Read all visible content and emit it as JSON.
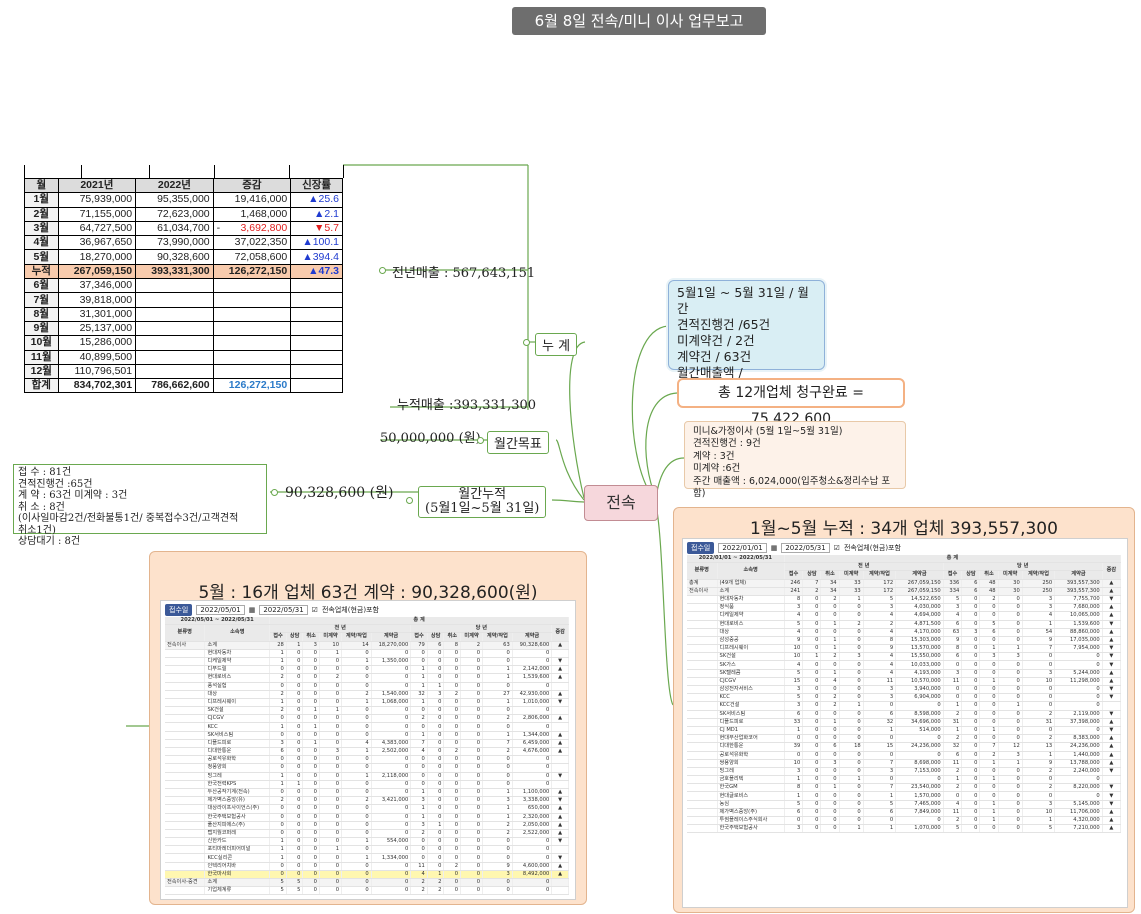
{
  "title": "6월 8일 전속/미니 이사 업무보고",
  "monthly_table": {
    "headers": [
      "월",
      "2021년",
      "2022년",
      "증감",
      "신장률"
    ],
    "rows": [
      {
        "month": "1월",
        "y2021": "75,939,000",
        "y2022": "95,355,000",
        "diff": "19,416,000",
        "rate": "▲25.6",
        "dir": "up"
      },
      {
        "month": "2월",
        "y2021": "71,155,000",
        "y2022": "72,623,000",
        "diff": "1,468,000",
        "rate": "▲2.1",
        "dir": "up"
      },
      {
        "month": "3월",
        "y2021": "64,727,500",
        "y2022": "61,034,700",
        "minus": "-",
        "diff": "3,692,800",
        "rate": "▼5.7",
        "dir": "down"
      },
      {
        "month": "4월",
        "y2021": "36,967,650",
        "y2022": "73,990,000",
        "diff": "37,022,350",
        "rate": "▲100.1",
        "dir": "up"
      },
      {
        "month": "5월",
        "y2021": "18,270,000",
        "y2022": "90,328,600",
        "diff": "72,058,600",
        "rate": "▲394.4",
        "dir": "up"
      }
    ],
    "cumulative": {
      "month": "누적",
      "y2021": "267,059,150",
      "y2022": "393,331,300",
      "diff": "126,272,150",
      "rate": "▲47.3"
    },
    "remaining": [
      {
        "month": "6월",
        "y2021": "37,346,000"
      },
      {
        "month": "7월",
        "y2021": "39,818,000"
      },
      {
        "month": "8월",
        "y2021": "31,301,000"
      },
      {
        "month": "9월",
        "y2021": "25,137,000"
      },
      {
        "month": "10월",
        "y2021": "15,286,000"
      },
      {
        "month": "11월",
        "y2021": "40,899,500"
      },
      {
        "month": "12월",
        "y2021": "110,796,501"
      }
    ],
    "total": {
      "month": "합계",
      "y2021": "834,702,301",
      "y2022": "786,662,600",
      "diff": "126,272,150"
    }
  },
  "labels": {
    "prev_year_sales": "전년매출 : 567,643,151",
    "cumulative_sales": "누적매출 :393,331,300",
    "cumulative_node": "누 계",
    "monthly_goal_value": "50,000,000 (원)",
    "monthly_goal_node": "월간목표",
    "monthly_cum_value": "90,328,600 (원)",
    "monthly_cum_node_1": "월간누적",
    "monthly_cum_node_2": "(5월1일~5월 31일)",
    "central": "전속"
  },
  "left_summary": [
    "접   수 : 81건",
    "견적진행건 :65건",
    "계   약  : 63건 미계약 : 3건",
    "취    소 : 8건",
    "(이사일마감2건/전화불통1건/ 중복접수3건/고객견적",
    "취소1건)",
    "상담대기 : 8건"
  ],
  "blue_box": [
    "5월1일 ~ 5월 31일 / 월간",
    "견적진행건 /65건",
    "미계약건 / 2건",
    "계약건 / 63건",
    "월간매출액 / 90,328,600원"
  ],
  "orange_box": "총 12개업체 청구완료 = 75,422,600",
  "peach_box": [
    "미니&가정이사 (5월 1일~5월 31일)",
    "견적진행건 : 9건",
    "계약 : 3건",
    "미계약 :6건",
    "주간 매출액 : 6,024,000(입주청소&정리수납 포함)"
  ],
  "left_panel": {
    "title": "5월 : 16개 업체  63건 계약 : 90,328,600(원)",
    "controls": {
      "chip": "접수일",
      "from": "2022/05/01",
      "to": "2022/05/31",
      "check": "전속업체(현금)포함"
    },
    "period": "2022/05/01 ~ 2022/05/31",
    "group": "총 계",
    "prev": "전   년",
    "curr": "당   년",
    "col_group": "분류명",
    "col_company": "소속명",
    "cols": [
      "접수",
      "상담",
      "취소",
      "미계약",
      "계약/작업",
      "계약금",
      "접수",
      "상담",
      "취소",
      "미계약",
      "계약/작업",
      "계약금",
      "증감"
    ],
    "rows": [
      [
        "전속이사",
        "소계",
        "28",
        "1",
        "3",
        "10",
        "14",
        "18,270,000",
        "79",
        "6",
        "8",
        "2",
        "63",
        "90,328,600",
        "▲"
      ],
      [
        "",
        "현대자동차",
        "1",
        "0",
        "0",
        "1",
        "0",
        "0",
        "0",
        "0",
        "0",
        "0",
        "0",
        "0",
        ""
      ],
      [
        "",
        "디케일제약",
        "1",
        "0",
        "0",
        "0",
        "1",
        "1,350,000",
        "0",
        "0",
        "0",
        "0",
        "0",
        "0",
        "▼"
      ],
      [
        "",
        "디푸드릴",
        "0",
        "0",
        "0",
        "0",
        "0",
        "0",
        "1",
        "0",
        "0",
        "0",
        "1",
        "2,142,000",
        "▲"
      ],
      [
        "",
        "현대로비스",
        "2",
        "0",
        "0",
        "2",
        "0",
        "0",
        "1",
        "0",
        "0",
        "0",
        "1",
        "1,539,600",
        "▲"
      ],
      [
        "",
        "풍석실험",
        "0",
        "0",
        "0",
        "0",
        "0",
        "0",
        "1",
        "1",
        "0",
        "0",
        "0",
        "0",
        ""
      ],
      [
        "",
        "대상",
        "2",
        "0",
        "0",
        "0",
        "2",
        "1,540,000",
        "32",
        "3",
        "2",
        "0",
        "27",
        "42,930,000",
        "▲"
      ],
      [
        "",
        "디프레시웨이",
        "1",
        "0",
        "0",
        "0",
        "1",
        "1,068,000",
        "1",
        "0",
        "0",
        "0",
        "1",
        "1,010,000",
        "▼"
      ],
      [
        "",
        "SK건설",
        "2",
        "0",
        "1",
        "1",
        "0",
        "0",
        "0",
        "0",
        "0",
        "0",
        "0",
        "0",
        ""
      ],
      [
        "",
        "CJCGV",
        "0",
        "0",
        "0",
        "0",
        "0",
        "0",
        "2",
        "0",
        "0",
        "0",
        "2",
        "2,806,000",
        "▲"
      ],
      [
        "",
        "KCC",
        "1",
        "0",
        "1",
        "0",
        "0",
        "0",
        "0",
        "0",
        "0",
        "0",
        "0",
        "0",
        ""
      ],
      [
        "",
        "SK서비스팀",
        "0",
        "0",
        "0",
        "0",
        "0",
        "0",
        "1",
        "0",
        "0",
        "0",
        "1",
        "1,344,000",
        "▲"
      ],
      [
        "",
        "디플드피로",
        "3",
        "0",
        "1",
        "0",
        "4",
        "4,383,000",
        "7",
        "0",
        "0",
        "0",
        "7",
        "6,459,000",
        "▲"
      ],
      [
        "",
        "디대한통운",
        "6",
        "0",
        "0",
        "3",
        "1",
        "2,502,000",
        "4",
        "0",
        "2",
        "0",
        "2",
        "4,676,000",
        "▲"
      ],
      [
        "",
        "공로석유화학",
        "0",
        "0",
        "0",
        "0",
        "0",
        "0",
        "0",
        "0",
        "0",
        "0",
        "0",
        "0",
        ""
      ],
      [
        "",
        "청풍양회",
        "0",
        "0",
        "0",
        "0",
        "0",
        "0",
        "0",
        "0",
        "0",
        "0",
        "0",
        "0",
        ""
      ],
      [
        "",
        "빙그레",
        "1",
        "0",
        "0",
        "0",
        "1",
        "2,118,000",
        "0",
        "0",
        "0",
        "0",
        "0",
        "0",
        "▼"
      ],
      [
        "",
        "한국전력KPS",
        "1",
        "1",
        "0",
        "0",
        "0",
        "0",
        "0",
        "0",
        "0",
        "0",
        "0",
        "0",
        ""
      ],
      [
        "",
        "두산공작기계(전속)",
        "0",
        "0",
        "0",
        "0",
        "0",
        "0",
        "1",
        "0",
        "0",
        "0",
        "1",
        "1,100,000",
        "▲"
      ],
      [
        "",
        "제가벽스중앙(유)",
        "2",
        "0",
        "0",
        "0",
        "2",
        "3,421,000",
        "3",
        "0",
        "0",
        "0",
        "3",
        "3,338,000",
        "▼"
      ],
      [
        "",
        "대상라이프사이언스(주)",
        "0",
        "0",
        "0",
        "0",
        "0",
        "0",
        "1",
        "0",
        "0",
        "0",
        "1",
        "650,000",
        "▲"
      ],
      [
        "",
        "한국주택보험공사",
        "0",
        "0",
        "0",
        "0",
        "0",
        "0",
        "1",
        "0",
        "0",
        "0",
        "1",
        "2,320,000",
        "▲"
      ],
      [
        "",
        "풀산지피에스(주)",
        "0",
        "0",
        "0",
        "0",
        "0",
        "0",
        "3",
        "1",
        "0",
        "0",
        "2",
        "2,050,000",
        "▲"
      ],
      [
        "",
        "랩지월코퍼레",
        "0",
        "0",
        "0",
        "0",
        "0",
        "0",
        "2",
        "0",
        "0",
        "0",
        "2",
        "2,522,000",
        "▲"
      ],
      [
        "",
        "신한카드",
        "1",
        "0",
        "0",
        "0",
        "1",
        "554,000",
        "0",
        "0",
        "0",
        "0",
        "0",
        "0",
        "▼"
      ],
      [
        "",
        "포티마레더피어미널",
        "1",
        "0",
        "0",
        "1",
        "0",
        "0",
        "0",
        "0",
        "0",
        "0",
        "0",
        "0",
        ""
      ],
      [
        "",
        "KCC실리콘",
        "1",
        "0",
        "0",
        "0",
        "1",
        "1,334,000",
        "0",
        "0",
        "0",
        "0",
        "0",
        "0",
        "▼"
      ],
      [
        "",
        "인텍리어치바",
        "0",
        "0",
        "0",
        "0",
        "0",
        "0",
        "11",
        "0",
        "2",
        "0",
        "9",
        "4,600,000",
        "▲"
      ],
      [
        "",
        "한국마사회",
        "0",
        "0",
        "0",
        "0",
        "0",
        "0",
        "4",
        "1",
        "0",
        "0",
        "3",
        "8,492,000",
        "▲"
      ],
      [
        "전속이사-중견",
        "소계",
        "5",
        "5",
        "0",
        "0",
        "0",
        "0",
        "2",
        "2",
        "0",
        "0",
        "0",
        "0",
        ""
      ],
      [
        "",
        "기업체계류",
        "5",
        "5",
        "0",
        "0",
        "0",
        "0",
        "2",
        "2",
        "0",
        "0",
        "0",
        "0",
        ""
      ]
    ]
  },
  "right_panel": {
    "title": "1월~5월 누적 : 34개 업체  393,557,300",
    "controls": {
      "chip": "접수일",
      "from": "2022/01/01",
      "to": "2022/05/31",
      "check": "전속업체(현금)포함"
    },
    "period": "2022/01/01 ~ 2022/05/31",
    "group": "총 계",
    "prev": "전   년",
    "curr": "당   년",
    "col_group": "분류명",
    "col_company": "소속명",
    "cols": [
      "접수",
      "상담",
      "취소",
      "미계약",
      "계약/작업",
      "계약금",
      "접수",
      "상담",
      "취소",
      "미계약",
      "계약/작업",
      "계약금",
      "증감"
    ],
    "rows": [
      [
        "총계",
        "(49개 업체)",
        "246",
        "7",
        "34",
        "33",
        "172",
        "267,059,150",
        "336",
        "6",
        "48",
        "30",
        "250",
        "393,557,300",
        "▲"
      ],
      [
        "전속이사",
        "소계",
        "241",
        "2",
        "34",
        "33",
        "172",
        "267,059,150",
        "334",
        "6",
        "48",
        "30",
        "250",
        "393,557,300",
        "▲"
      ],
      [
        "",
        "현대자동차",
        "8",
        "0",
        "2",
        "1",
        "5",
        "14,522,650",
        "5",
        "0",
        "2",
        "0",
        "3",
        "7,755,700",
        "▼"
      ],
      [
        "",
        "정식품",
        "3",
        "0",
        "0",
        "0",
        "3",
        "4,030,000",
        "3",
        "0",
        "0",
        "0",
        "3",
        "7,680,000",
        "▲"
      ],
      [
        "",
        "디케일제약",
        "4",
        "0",
        "0",
        "0",
        "4",
        "4,694,000",
        "4",
        "0",
        "0",
        "0",
        "4",
        "10,065,000",
        "▲"
      ],
      [
        "",
        "현대로비스",
        "5",
        "0",
        "1",
        "2",
        "2",
        "4,871,500",
        "6",
        "0",
        "5",
        "0",
        "1",
        "1,539,600",
        "▼"
      ],
      [
        "",
        "대상",
        "4",
        "0",
        "0",
        "0",
        "4",
        "4,170,000",
        "63",
        "3",
        "6",
        "0",
        "54",
        "88,860,000",
        "▲"
      ],
      [
        "",
        "삼성중공",
        "9",
        "0",
        "1",
        "0",
        "8",
        "15,303,000",
        "9",
        "0",
        "0",
        "0",
        "9",
        "17,035,000",
        "▲"
      ],
      [
        "",
        "디프레시웨이",
        "10",
        "0",
        "1",
        "0",
        "9",
        "13,570,000",
        "8",
        "0",
        "1",
        "1",
        "7",
        "7,954,000",
        "▼"
      ],
      [
        "",
        "SK건설",
        "10",
        "1",
        "2",
        "3",
        "4",
        "15,550,000",
        "6",
        "0",
        "3",
        "3",
        "0",
        "0",
        "▼"
      ],
      [
        "",
        "SK가스",
        "4",
        "0",
        "0",
        "0",
        "4",
        "10,033,000",
        "0",
        "0",
        "0",
        "0",
        "0",
        "0",
        "▼"
      ],
      [
        "",
        "SK텔레콤",
        "5",
        "0",
        "1",
        "0",
        "4",
        "4,193,000",
        "3",
        "0",
        "0",
        "0",
        "3",
        "5,244,000",
        "▲"
      ],
      [
        "",
        "CJCGV",
        "15",
        "0",
        "4",
        "0",
        "11",
        "10,570,000",
        "11",
        "0",
        "1",
        "0",
        "10",
        "11,298,000",
        "▲"
      ],
      [
        "",
        "삼성전자서비스",
        "3",
        "0",
        "0",
        "0",
        "3",
        "3,940,000",
        "0",
        "0",
        "0",
        "0",
        "0",
        "0",
        "▼"
      ],
      [
        "",
        "KCC",
        "5",
        "0",
        "2",
        "0",
        "3",
        "6,904,000",
        "0",
        "0",
        "0",
        "0",
        "0",
        "0",
        "▼"
      ],
      [
        "",
        "KCC건설",
        "3",
        "0",
        "2",
        "1",
        "0",
        "0",
        "1",
        "0",
        "0",
        "1",
        "0",
        "0",
        ""
      ],
      [
        "",
        "SK서비스팀",
        "6",
        "0",
        "0",
        "0",
        "6",
        "8,598,000",
        "2",
        "0",
        "0",
        "0",
        "2",
        "2,119,000",
        "▼"
      ],
      [
        "",
        "디플드피로",
        "33",
        "0",
        "1",
        "0",
        "32",
        "34,696,000",
        "31",
        "0",
        "0",
        "0",
        "31",
        "37,398,000",
        "▲"
      ],
      [
        "",
        "CJ MD1",
        "1",
        "0",
        "0",
        "0",
        "1",
        "514,000",
        "1",
        "0",
        "1",
        "0",
        "0",
        "0",
        "▼"
      ],
      [
        "",
        "현대무산업화코어",
        "0",
        "0",
        "0",
        "0",
        "0",
        "0",
        "2",
        "0",
        "0",
        "0",
        "2",
        "8,383,000",
        "▲"
      ],
      [
        "",
        "디대한통운",
        "39",
        "0",
        "6",
        "18",
        "15",
        "24,236,000",
        "32",
        "0",
        "7",
        "12",
        "13",
        "24,236,000",
        "▲"
      ],
      [
        "",
        "공로석유화학",
        "0",
        "0",
        "0",
        "0",
        "0",
        "0",
        "6",
        "0",
        "2",
        "3",
        "1",
        "1,440,000",
        "▲"
      ],
      [
        "",
        "쌍용양회",
        "10",
        "0",
        "3",
        "0",
        "7",
        "8,698,000",
        "11",
        "0",
        "1",
        "1",
        "9",
        "13,788,000",
        "▲"
      ],
      [
        "",
        "빙그레",
        "3",
        "0",
        "0",
        "0",
        "3",
        "7,153,000",
        "2",
        "0",
        "0",
        "0",
        "2",
        "2,240,000",
        "▼"
      ],
      [
        "",
        "금호플리텍",
        "1",
        "0",
        "0",
        "1",
        "0",
        "0",
        "1",
        "0",
        "1",
        "0",
        "0",
        "0",
        ""
      ],
      [
        "",
        "한국GM",
        "8",
        "0",
        "1",
        "0",
        "7",
        "23,540,000",
        "2",
        "0",
        "0",
        "0",
        "2",
        "8,220,000",
        "▼"
      ],
      [
        "",
        "현대글로비스",
        "1",
        "0",
        "0",
        "0",
        "1",
        "1,570,000",
        "0",
        "0",
        "0",
        "0",
        "0",
        "0",
        "▼"
      ],
      [
        "",
        "농심",
        "5",
        "0",
        "0",
        "0",
        "5",
        "7,465,000",
        "4",
        "0",
        "1",
        "0",
        "3",
        "5,145,000",
        "▼"
      ],
      [
        "",
        "제가벽스중앙(주)",
        "6",
        "0",
        "0",
        "0",
        "6",
        "7,849,000",
        "11",
        "0",
        "1",
        "0",
        "10",
        "11,706,000",
        "▲"
      ],
      [
        "",
        "투썸플레이스주식회사",
        "0",
        "0",
        "0",
        "0",
        "0",
        "0",
        "2",
        "0",
        "1",
        "0",
        "1",
        "4,320,000",
        "▲"
      ],
      [
        "",
        "한국주택보험공사",
        "3",
        "0",
        "0",
        "1",
        "1",
        "1,070,000",
        "5",
        "0",
        "0",
        "0",
        "5",
        "7,210,000",
        "▲"
      ]
    ]
  }
}
